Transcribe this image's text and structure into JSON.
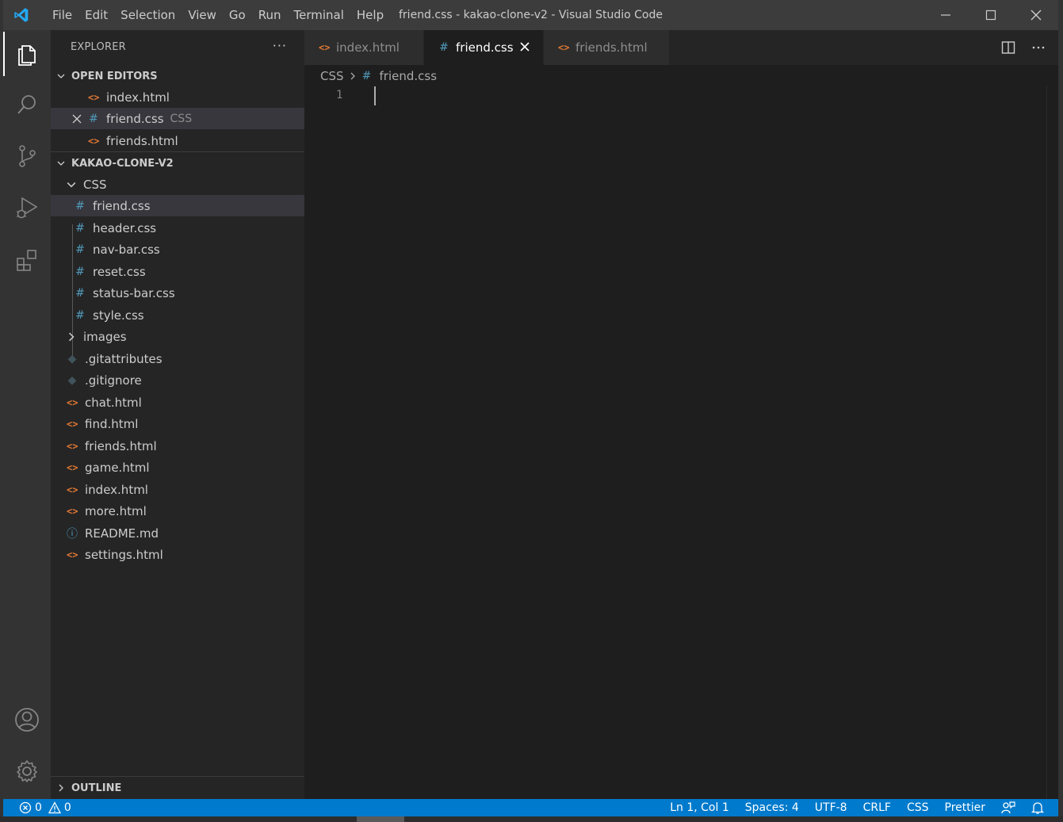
{
  "titlebar": {
    "window_title": "friend.css - kakao-clone-v2 - Visual Studio Code",
    "menu": [
      "File",
      "Edit",
      "Selection",
      "View",
      "Go",
      "Run",
      "Terminal",
      "Help"
    ]
  },
  "activitybar": {
    "items": [
      "explorer",
      "search",
      "source-control",
      "run-debug",
      "extensions"
    ],
    "bottom": [
      "accounts",
      "manage"
    ]
  },
  "sidebar": {
    "title": "EXPLORER",
    "more": "···",
    "open_editors": {
      "label": "OPEN EDITORS",
      "items": [
        {
          "name": "index.html",
          "type": "html"
        },
        {
          "name": "friend.css",
          "type": "css",
          "desc": "CSS"
        },
        {
          "name": "friends.html",
          "type": "html"
        }
      ]
    },
    "project": {
      "label": "KAKAO-CLONE-V2",
      "css_folder": "CSS",
      "css_files": [
        "friend.css",
        "header.css",
        "nav-bar.css",
        "reset.css",
        "status-bar.css",
        "style.css"
      ],
      "images_folder": "images",
      "files": [
        {
          "name": ".gitattributes",
          "type": "git"
        },
        {
          "name": ".gitignore",
          "type": "git"
        },
        {
          "name": "chat.html",
          "type": "html"
        },
        {
          "name": "find.html",
          "type": "html"
        },
        {
          "name": "friends.html",
          "type": "html"
        },
        {
          "name": "game.html",
          "type": "html"
        },
        {
          "name": "index.html",
          "type": "html"
        },
        {
          "name": "more.html",
          "type": "html"
        },
        {
          "name": "README.md",
          "type": "info"
        },
        {
          "name": "settings.html",
          "type": "html"
        }
      ]
    },
    "outline": "OUTLINE"
  },
  "editor": {
    "tabs": [
      {
        "name": "index.html",
        "type": "html"
      },
      {
        "name": "friend.css",
        "type": "css",
        "active": true
      },
      {
        "name": "friends.html",
        "type": "html"
      }
    ],
    "breadcrumb": [
      "CSS",
      "friend.css"
    ],
    "line_number": "1"
  },
  "icons": {
    "html": "<>",
    "css": "#",
    "info": "ⓘ",
    "git": "◆"
  },
  "statusbar": {
    "errors": "0",
    "warnings": "0",
    "position": "Ln 1, Col 1",
    "spaces": "Spaces: 4",
    "encoding": "UTF-8",
    "eol": "CRLF",
    "language": "CSS",
    "formatter": "Prettier"
  },
  "colors": {
    "accent": "#007acc",
    "html_icon": "#e37933",
    "css_icon": "#519aba"
  }
}
